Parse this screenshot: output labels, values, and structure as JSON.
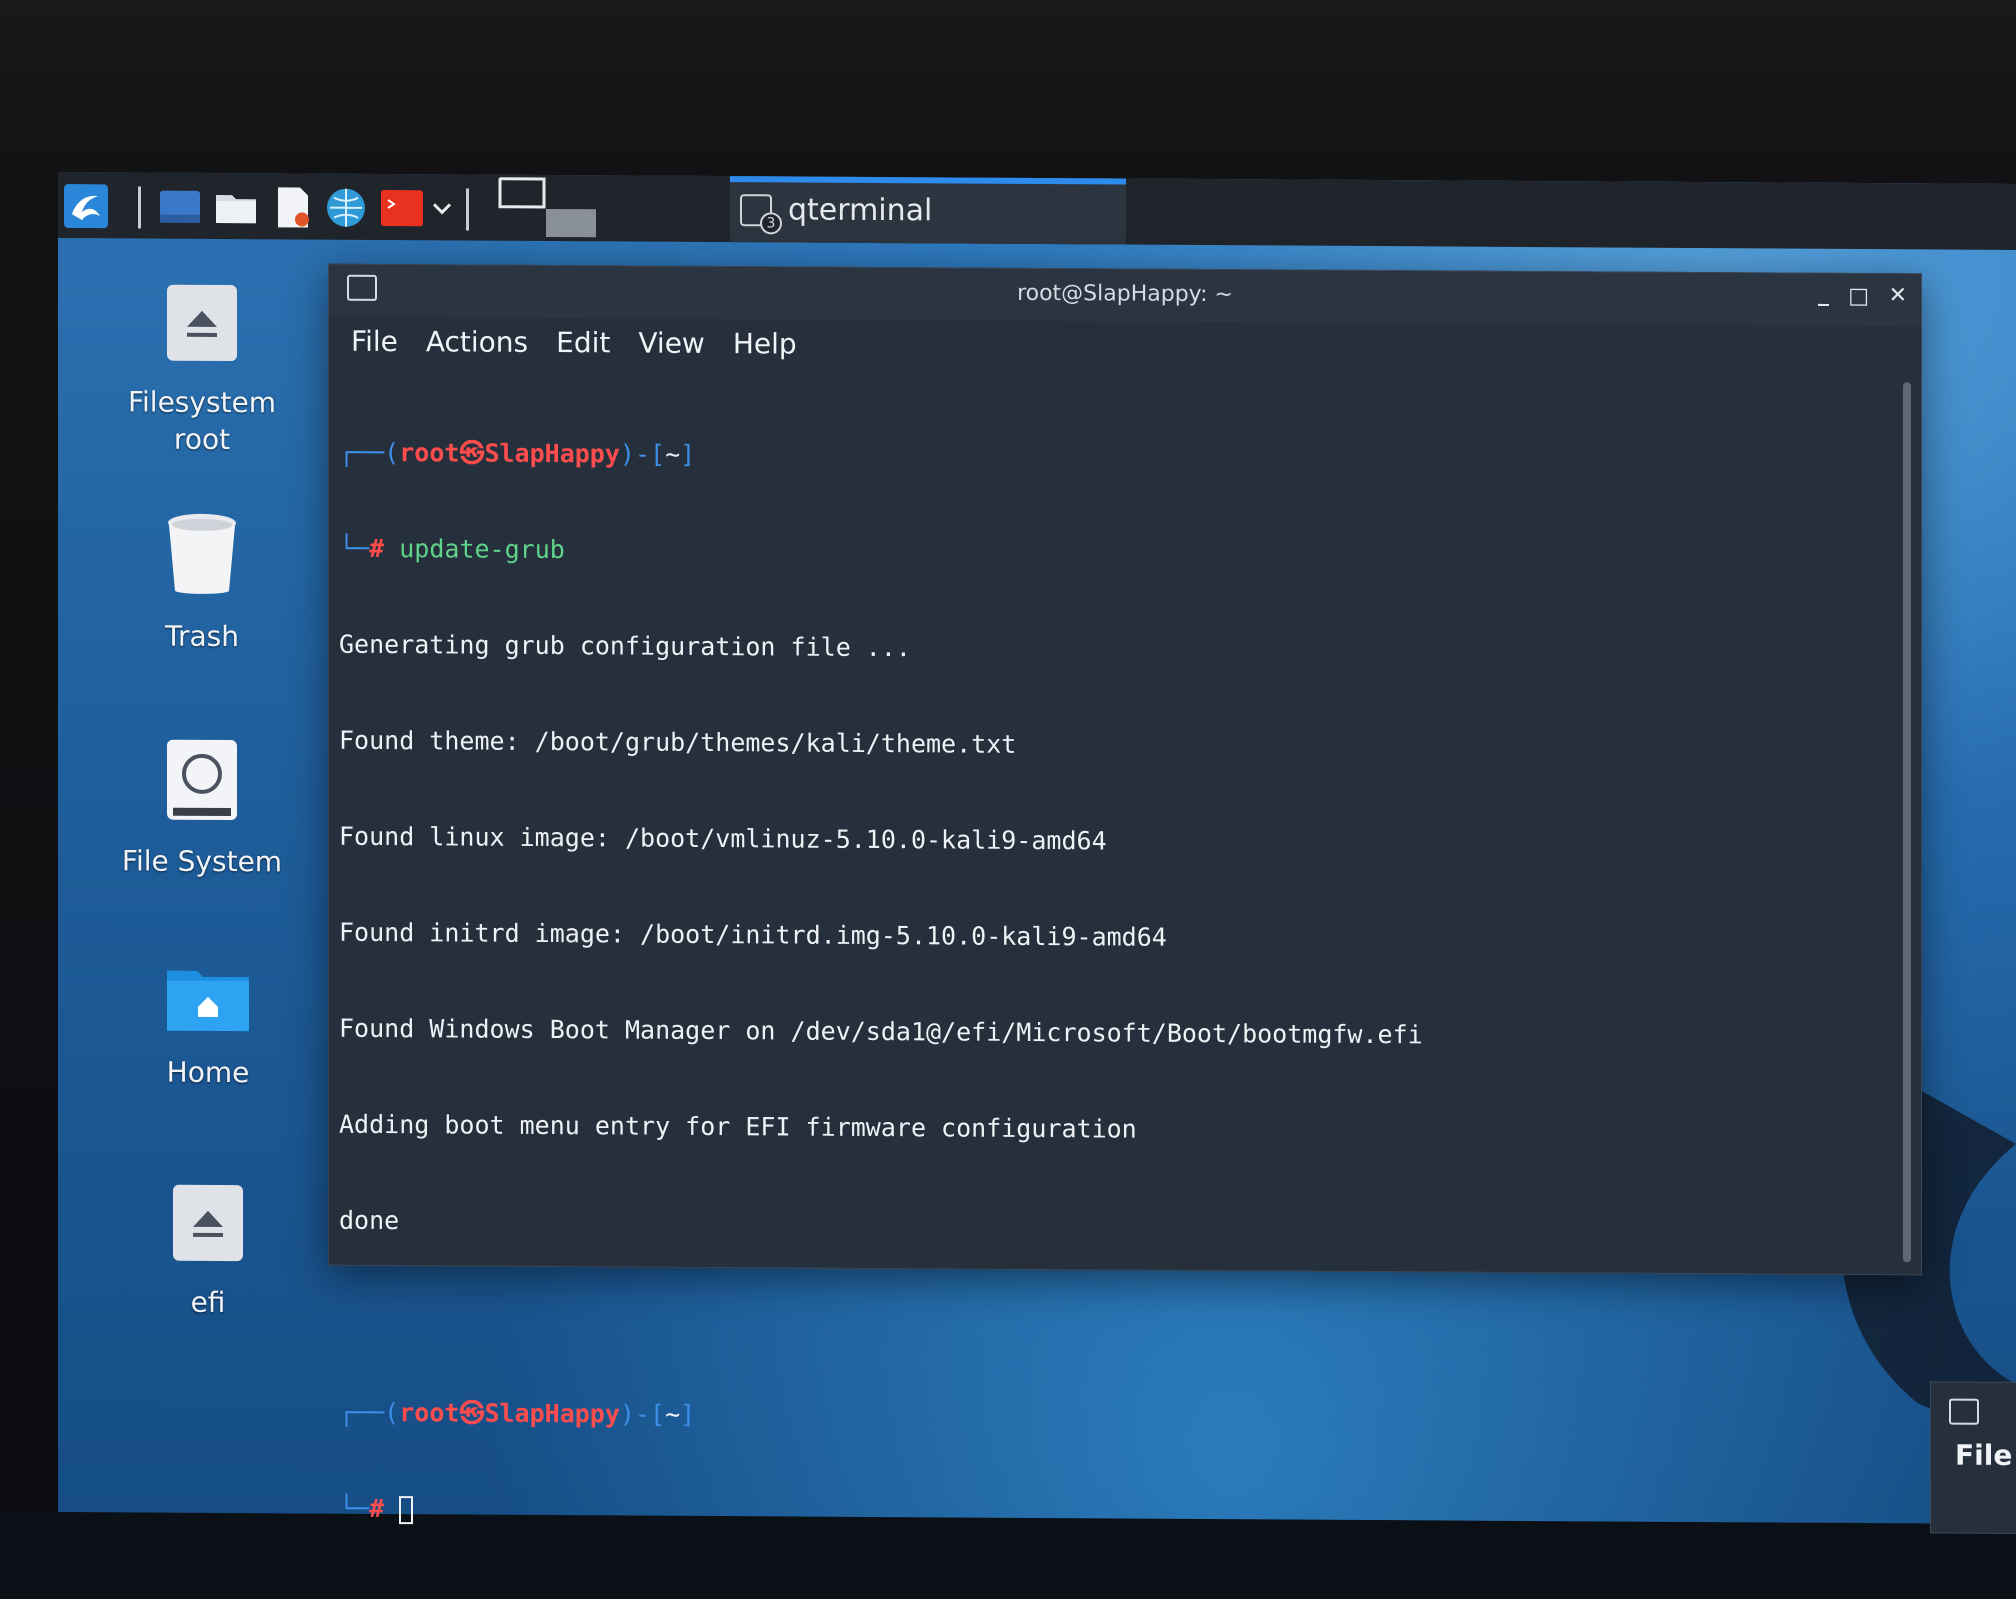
{
  "taskbar": {
    "active_window_title": "qterminal",
    "active_window_count_badge": "3",
    "icons": [
      "kali-menu-icon",
      "show-desktop-icon",
      "file-manager-icon",
      "text-editor-icon",
      "web-browser-icon",
      "terminal-icon",
      "dropdown-chevron-icon",
      "workspace-switcher-icon"
    ]
  },
  "desktop": {
    "icons": [
      {
        "label_line1": "Filesystem",
        "label_line2": "root",
        "icon": "drive-eject-icon"
      },
      {
        "label_line1": "Trash",
        "label_line2": "",
        "icon": "trash-icon"
      },
      {
        "label_line1": "File System",
        "label_line2": "",
        "icon": "filesystem-disk-icon"
      },
      {
        "label_line1": "Home",
        "label_line2": "",
        "icon": "home-folder-icon"
      },
      {
        "label_line1": "efi",
        "label_line2": "",
        "icon": "drive-eject-icon"
      }
    ]
  },
  "terminal": {
    "title": "root@SlapHappy: ~",
    "menu": [
      "File",
      "Actions",
      "Edit",
      "View",
      "Help"
    ],
    "prompt_user": "root",
    "prompt_host": "SlapHappy",
    "prompt_dir": "~",
    "command": "update-grub",
    "output": [
      "Generating grub configuration file ...",
      "Found theme: /boot/grub/themes/kali/theme.txt",
      "Found linux image: /boot/vmlinuz-5.10.0-kali9-amd64",
      "Found initrd image: /boot/initrd.img-5.10.0-kali9-amd64",
      "Found Windows Boot Manager on /dev/sda1@/efi/Microsoft/Boot/bootmgfw.efi",
      "Adding boot menu entry for EFI firmware configuration",
      "done"
    ]
  },
  "second_window": {
    "menu_first": "File"
  },
  "colors": {
    "prompt_user": "#ff4d4d",
    "prompt_bracket": "#3d8ee6",
    "command": "#5fd38a",
    "taskbar_active_accent": "#2d8ceb"
  }
}
